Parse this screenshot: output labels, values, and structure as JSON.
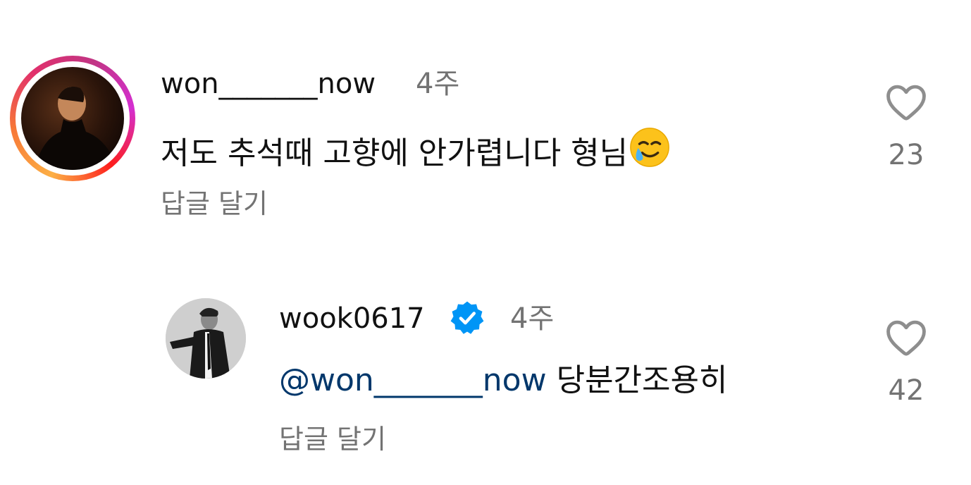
{
  "comments": [
    {
      "username": "won_______now",
      "time": "4주",
      "text": "저도 추석때 고향에 안가렵니다 형님",
      "emoji": "smiling-face-with-tear",
      "reply_label": "답글 달기",
      "likes": "23"
    },
    {
      "username": "wook0617",
      "verified": true,
      "time": "4주",
      "mention": "@won_______now",
      "text": "당분간조용히",
      "reply_label": "답글 달기",
      "likes": "42"
    }
  ],
  "colors": {
    "mention": "#00376b",
    "verified": "#0095f6",
    "secondary_text": "#737373"
  }
}
